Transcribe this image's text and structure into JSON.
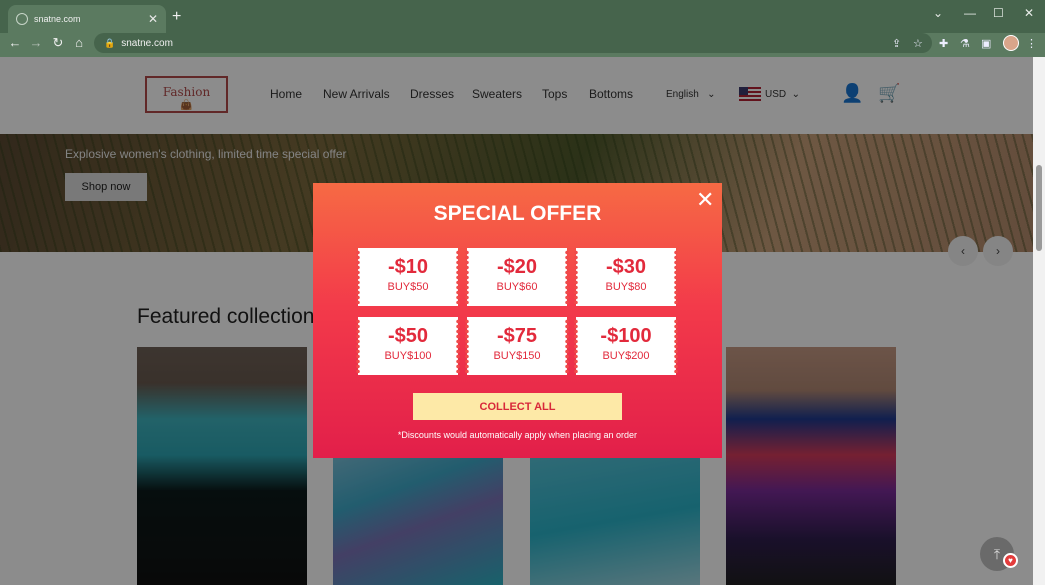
{
  "browser": {
    "tab_title": "snatne.com",
    "tab_close": "✕",
    "new_tab": "+",
    "url": "snatne.com",
    "window_controls": [
      "⌄",
      "—",
      "☐",
      "✕"
    ]
  },
  "header": {
    "logo_text": "Fashion",
    "nav": [
      "Home",
      "New Arrivals",
      "Dresses",
      "Sweaters",
      "Tops",
      "Bottoms"
    ],
    "language": "English",
    "currency": "USD"
  },
  "hero": {
    "subtitle": "Explosive women's clothing, limited time special offer",
    "cta": "Shop now"
  },
  "featured": {
    "title": "Featured collection"
  },
  "modal": {
    "title": "SPECIAL OFFER",
    "coupons": [
      {
        "amount": "-$10",
        "condition": "BUY$50"
      },
      {
        "amount": "-$20",
        "condition": "BUY$60"
      },
      {
        "amount": "-$30",
        "condition": "BUY$80"
      },
      {
        "amount": "-$50",
        "condition": "BUY$100"
      },
      {
        "amount": "-$75",
        "condition": "BUY$150"
      },
      {
        "amount": "-$100",
        "condition": "BUY$200"
      }
    ],
    "collect_label": "COLLECT ALL",
    "note": "*Discounts would automatically apply when placing an order"
  },
  "colors": {
    "modal_top": "#f66a44",
    "modal_bottom": "#e21f4a",
    "collect_button": "#fde9a7"
  }
}
